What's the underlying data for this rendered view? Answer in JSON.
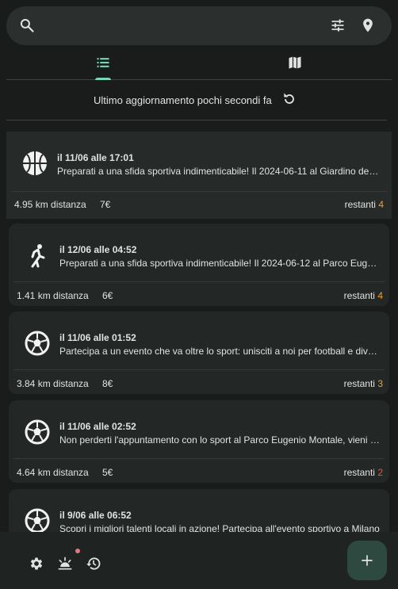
{
  "search": {
    "icons": {
      "search": "search-icon",
      "filter": "tune-icon",
      "location": "location-pin-icon"
    }
  },
  "tabs": [
    {
      "name": "list",
      "icon": "list-icon",
      "active": true
    },
    {
      "name": "map",
      "icon": "map-icon",
      "active": false
    }
  ],
  "update": {
    "text": "Ultimo aggiornamento pochi secondi fa",
    "icon": "refresh-icon"
  },
  "events": [
    {
      "icon": "basketball-icon",
      "date": "il 11/06 alle 17:01",
      "description": "Preparati a una sfida sportiva indimenticabile! Il 2024-06-11 al Giardino dei Tigli",
      "distance": "4.95 km distanza",
      "price": "7€",
      "remaining_label": "restanti",
      "remaining": "4",
      "remaining_color": "#f0a030"
    },
    {
      "icon": "running-icon",
      "date": "il 12/06 alle 04:52",
      "description": "Preparati a una sfida sportiva indimenticabile! Il 2024-06-12 al Parco Eugenio Montale",
      "distance": "1.41 km distanza",
      "price": "6€",
      "remaining_label": "restanti",
      "remaining": "4",
      "remaining_color": "#f0a030"
    },
    {
      "icon": "soccer-ball-icon",
      "date": "il 11/06 alle 01:52",
      "description": "Partecipa a un evento che va oltre lo sport: unisciti a noi per football e divertimento",
      "distance": "3.84 km distanza",
      "price": "8€",
      "remaining_label": "restanti",
      "remaining": "3",
      "remaining_color": "#f0a030"
    },
    {
      "icon": "soccer-ball-icon",
      "date": "il 11/06 alle 02:52",
      "description": "Non perderti l'appuntamento con lo sport al Parco Eugenio Montale, vieni a giocare",
      "distance": "4.64 km distanza",
      "price": "5€",
      "remaining_label": "restanti",
      "remaining": "2",
      "remaining_color": "#e8564a"
    },
    {
      "icon": "soccer-ball-icon",
      "date": "il 9/06 alle 06:52",
      "description": "Scopri i migliori talenti locali in azione! Partecipa all'evento sportivo a Milano",
      "distance": "",
      "price": "",
      "remaining_label": "",
      "remaining": "",
      "remaining_color": "#f0a030"
    }
  ],
  "bottom_nav": {
    "icons": {
      "settings": "gear-icon",
      "sunrise": "sunrise-icon",
      "history": "history-icon"
    },
    "notification_dot_color": "#e07880"
  },
  "fab": {
    "icon": "plus-icon",
    "color": "#2e4a40"
  },
  "colors": {
    "accent": "#7ad7b5",
    "background": "#191c1b",
    "card": "#232826"
  }
}
